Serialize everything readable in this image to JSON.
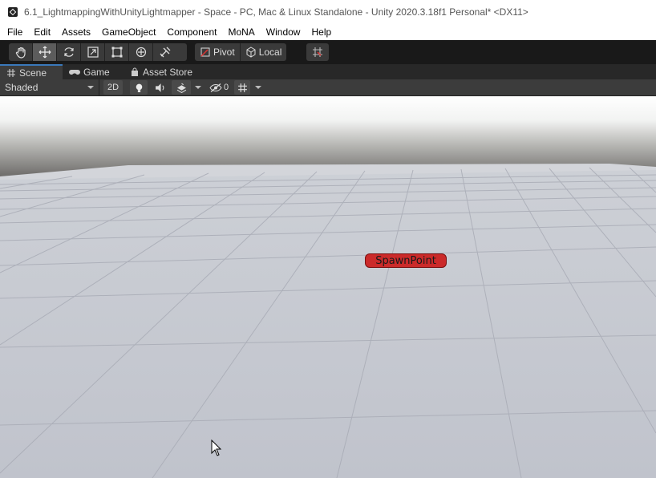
{
  "window": {
    "title": "6.1_LightmappingWithUnityLightmapper - Space - PC, Mac & Linux Standalone - Unity 2020.3.18f1 Personal* <DX11>"
  },
  "menu": [
    "File",
    "Edit",
    "Assets",
    "GameObject",
    "Component",
    "MoNA",
    "Window",
    "Help"
  ],
  "toolbar": {
    "tools": [
      {
        "name": "hand-tool",
        "icon": "hand-icon",
        "active": false
      },
      {
        "name": "move-tool",
        "icon": "move-icon",
        "active": true
      },
      {
        "name": "rotate-tool",
        "icon": "rotate-icon",
        "active": false
      },
      {
        "name": "scale-tool",
        "icon": "scale-icon",
        "active": false
      },
      {
        "name": "rect-tool",
        "icon": "rect-icon",
        "active": false
      },
      {
        "name": "transform-tool",
        "icon": "transform-icon",
        "active": false
      },
      {
        "name": "custom-tool",
        "icon": "tools-icon",
        "active": false
      }
    ],
    "pivot_label": "Pivot",
    "local_label": "Local"
  },
  "tabs": [
    {
      "label": "Scene",
      "icon": "grid-icon",
      "active": true
    },
    {
      "label": "Game",
      "icon": "gamepad-icon",
      "active": false
    },
    {
      "label": "Asset Store",
      "icon": "store-bag-icon",
      "active": false
    }
  ],
  "scene_toolbar": {
    "shading_mode": "Shaded",
    "mode_2d_label": "2D",
    "hidden_count": "0"
  },
  "scene": {
    "object_label": "SpawnPoint",
    "label_color": "#cb2a2a"
  },
  "colors": {
    "toolbar_bg": "#191919",
    "panel_bg": "#3c3c3c",
    "tab_accent": "#3a79bb"
  }
}
